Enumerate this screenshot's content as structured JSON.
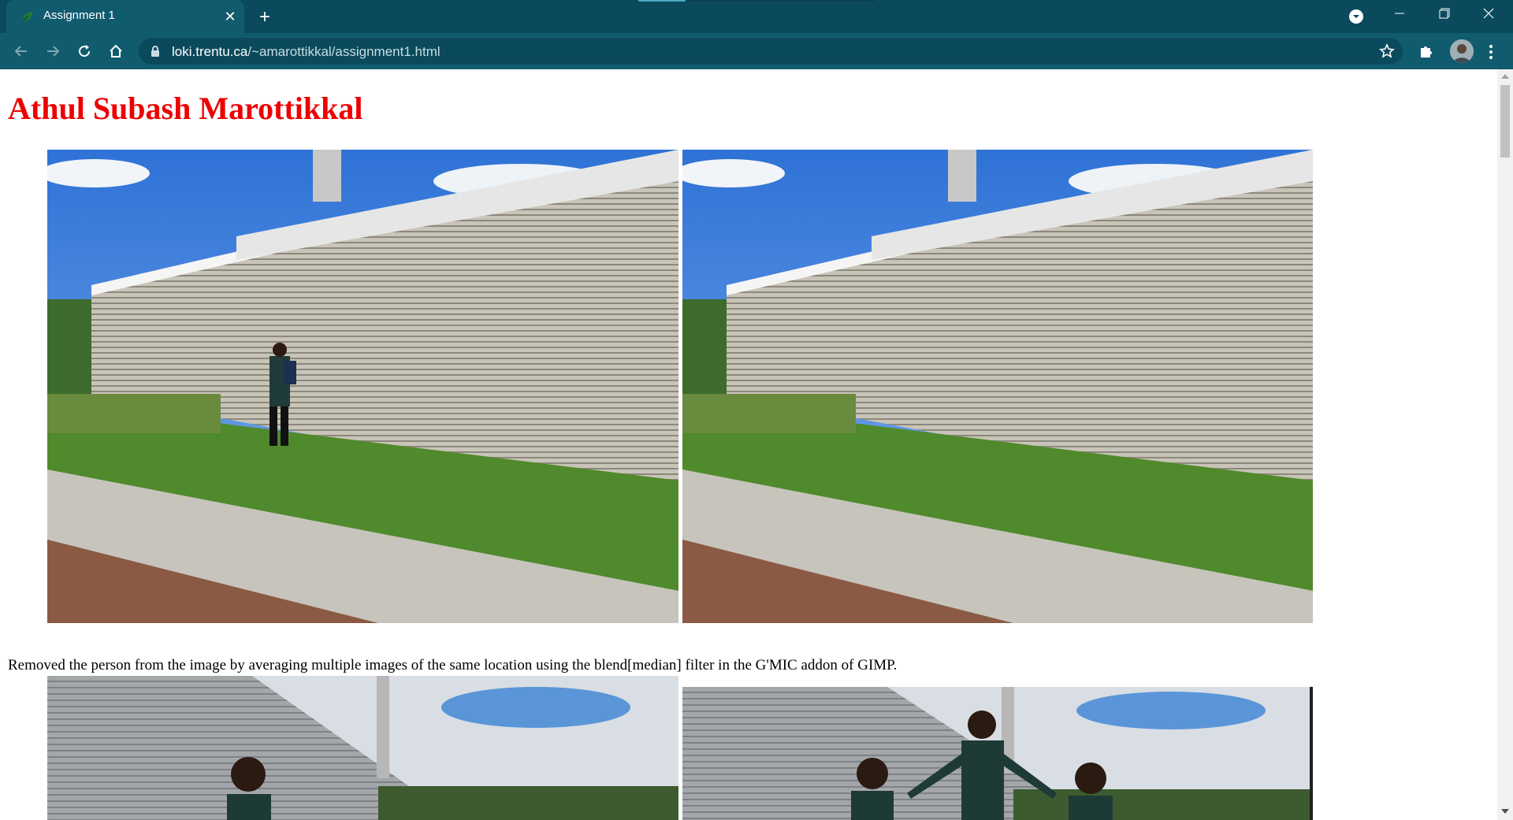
{
  "browser": {
    "tab_title": "Assignment 1",
    "url_host": "loki.trentu.ca",
    "url_path": "/~amarottikkal/assignment1.html",
    "accent": "#0b4a5c"
  },
  "page": {
    "heading": "Athul Subash Marottikkal",
    "heading_color": "#ee0000",
    "caption": "Removed the person from the image by averaging multiple images of the same location using the blend[median] filter in the G'MIC addon of GIMP."
  }
}
